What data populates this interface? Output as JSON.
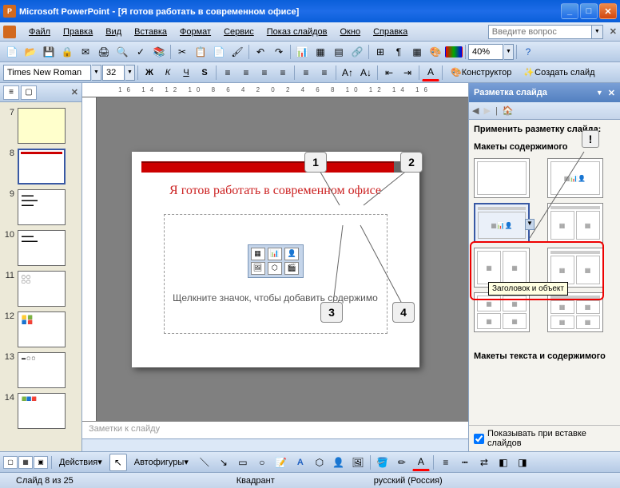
{
  "app": {
    "name": "Microsoft PowerPoint",
    "doc": "[Я готов работать в современном офисе]"
  },
  "menu": {
    "file": "Файл",
    "edit": "Правка",
    "view": "Вид",
    "insert": "Вставка",
    "format": "Формат",
    "tools": "Сервис",
    "slideshow": "Показ слайдов",
    "window": "Окно",
    "help": "Справка",
    "ask_placeholder": "Введите вопрос"
  },
  "toolbar": {
    "font": "Times New Roman",
    "size": "32",
    "zoom": "40%",
    "designer": "Конструктор",
    "newslide": "Создать слайд"
  },
  "thumbs": [
    {
      "n": "7"
    },
    {
      "n": "8"
    },
    {
      "n": "9"
    },
    {
      "n": "10"
    },
    {
      "n": "11"
    },
    {
      "n": "12"
    },
    {
      "n": "13"
    },
    {
      "n": "14"
    }
  ],
  "slide": {
    "title": "Я готов работать в современном офисе",
    "ph_text": "Щелкните значок, чтобы добавить содержимо"
  },
  "callouts": {
    "c1": "1",
    "c2": "2",
    "c3": "3",
    "c4": "4",
    "excl": "!"
  },
  "notes": {
    "placeholder": "Заметки к слайду"
  },
  "taskpane": {
    "title": "Разметка слайда",
    "apply": "Применить разметку слайда:",
    "section1": "Макеты содержимого",
    "section2": "Макеты текста и содержимого",
    "tooltip": "Заголовок и объект",
    "show_on_insert": "Показывать при вставке слайдов"
  },
  "drawbar": {
    "actions": "Действия",
    "autoshapes": "Автофигуры"
  },
  "status": {
    "slide": "Слайд 8 из 25",
    "theme": "Квадрант",
    "lang": "русский (Россия)"
  }
}
